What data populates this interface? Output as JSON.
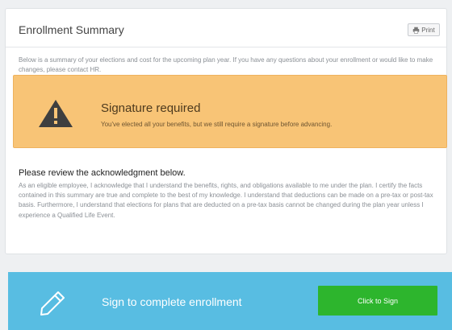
{
  "summary": {
    "title": "Enrollment Summary",
    "print_label": "Print",
    "intro": "Below is a summary of your elections and cost for the upcoming plan year. If you have any questions about your enrollment or would like to make changes, please contact HR."
  },
  "alert": {
    "icon": "warning-icon",
    "title": "Signature required",
    "body": "You've elected all your benefits, but we still require a signature before advancing."
  },
  "acknowledgment": {
    "heading": "Please review the acknowledgment below.",
    "text": "As an eligible employee, I acknowledge that I understand the benefits, rights, and obligations available to me under the plan. I certify the facts contained in this summary are true and complete to the best of my knowledge. I understand that deductions can be made on a pre-tax or post-tax basis. Furthermore, I understand that elections for plans that are deducted on a pre-tax basis cannot be changed during the plan year unless I experience a Qualified Life Event."
  },
  "sign": {
    "icon": "pencil-icon",
    "label": "Sign to complete enrollment",
    "button_label": "Click to Sign"
  },
  "colors": {
    "alert_bg": "#f8c476",
    "sign_panel_bg": "#58bde2",
    "sign_button_bg": "#2db52d"
  }
}
